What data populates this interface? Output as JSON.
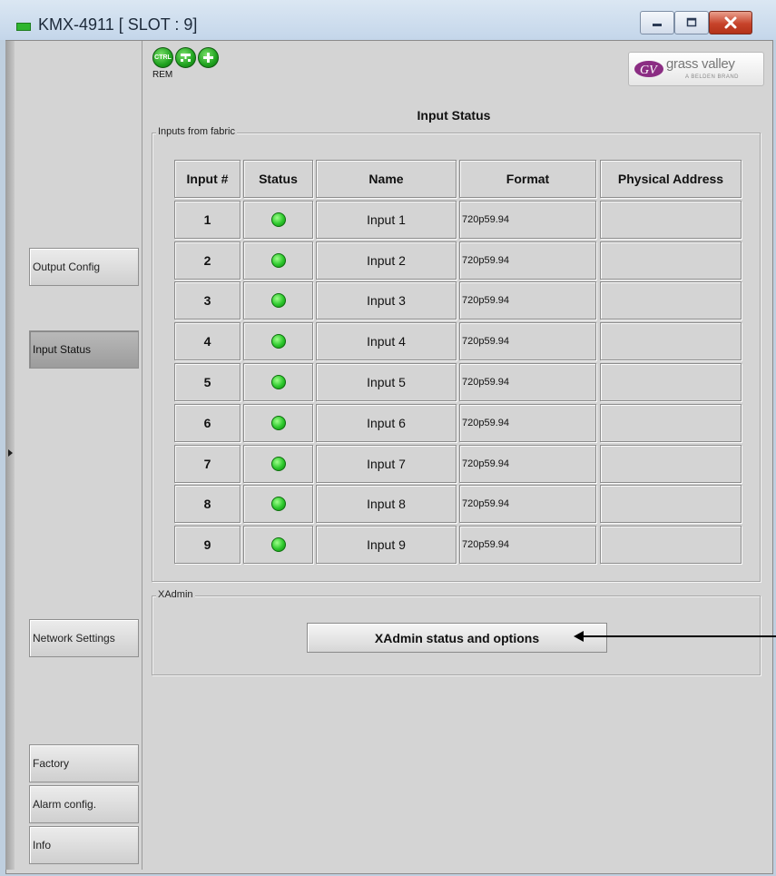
{
  "window": {
    "title": "KMX-4911 [ SLOT : 9]"
  },
  "toolbar": {
    "icons": [
      "ctrl-icon",
      "network-icon",
      "add-icon"
    ],
    "ctrl_label": "CTRL",
    "rem_label": "REM"
  },
  "logo": {
    "text": "grass valley",
    "subtext": "A BELDEN BRAND"
  },
  "nav": {
    "items": [
      {
        "label": "Output Config",
        "active": false
      },
      {
        "label": "Input Status",
        "active": true
      },
      {
        "label": "Network Settings",
        "active": false
      },
      {
        "label": "Factory",
        "active": false
      },
      {
        "label": "Alarm config.",
        "active": false
      },
      {
        "label": "Info",
        "active": false
      }
    ]
  },
  "main": {
    "title": "Input Status",
    "fabric_group": "Inputs from fabric",
    "table": {
      "headers": [
        "Input #",
        "Status",
        "Name",
        "Format",
        "Physical Address"
      ],
      "rows": [
        {
          "num": "1",
          "status": "green",
          "name": "Input 1",
          "format": "720p59.94",
          "address": ""
        },
        {
          "num": "2",
          "status": "green",
          "name": "Input 2",
          "format": "720p59.94",
          "address": ""
        },
        {
          "num": "3",
          "status": "green",
          "name": "Input 3",
          "format": "720p59.94",
          "address": ""
        },
        {
          "num": "4",
          "status": "green",
          "name": "Input 4",
          "format": "720p59.94",
          "address": ""
        },
        {
          "num": "5",
          "status": "green",
          "name": "Input 5",
          "format": "720p59.94",
          "address": ""
        },
        {
          "num": "6",
          "status": "green",
          "name": "Input 6",
          "format": "720p59.94",
          "address": ""
        },
        {
          "num": "7",
          "status": "green",
          "name": "Input 7",
          "format": "720p59.94",
          "address": ""
        },
        {
          "num": "8",
          "status": "green",
          "name": "Input 8",
          "format": "720p59.94",
          "address": ""
        },
        {
          "num": "9",
          "status": "green",
          "name": "Input 9",
          "format": "720p59.94",
          "address": ""
        }
      ]
    },
    "xadmin_group": "XAdmin",
    "xadmin_button": "XAdmin status and options"
  },
  "colors": {
    "status_ok": "#2cc72c",
    "close_button": "#c7432a"
  }
}
